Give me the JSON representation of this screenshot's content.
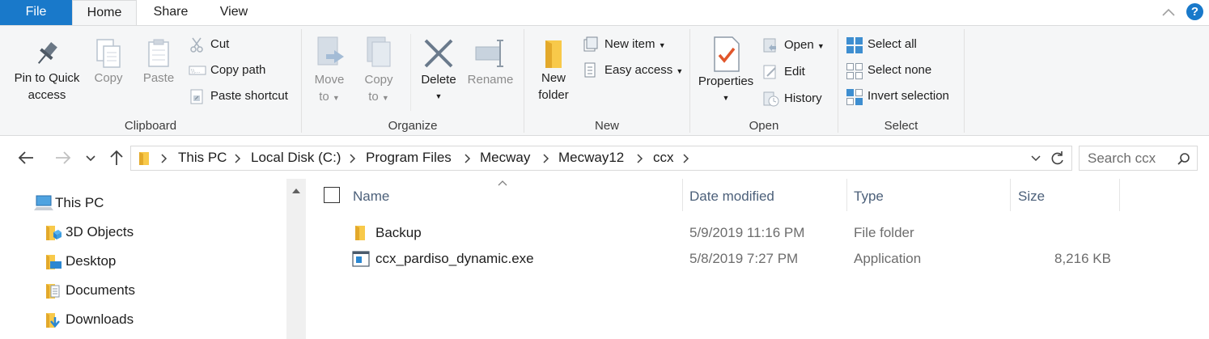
{
  "tabs": {
    "file": "File",
    "home": "Home",
    "share": "Share",
    "view": "View"
  },
  "help": "?",
  "ribbon": {
    "clipboard": {
      "label": "Clipboard",
      "pin": [
        "Pin to Quick",
        "access"
      ],
      "copy": "Copy",
      "paste": "Paste",
      "cut": "Cut",
      "copy_path": "Copy path",
      "paste_shortcut": "Paste shortcut"
    },
    "organize": {
      "label": "Organize",
      "move_to": [
        "Move",
        "to"
      ],
      "copy_to": [
        "Copy",
        "to"
      ],
      "delete": "Delete",
      "rename": "Rename"
    },
    "new": {
      "label": "New",
      "new_folder": [
        "New",
        "folder"
      ],
      "new_item": "New item",
      "easy_access": "Easy access"
    },
    "open": {
      "label": "Open",
      "properties": "Properties",
      "open": "Open",
      "edit": "Edit",
      "history": "History"
    },
    "select": {
      "label": "Select",
      "select_all": "Select all",
      "select_none": "Select none",
      "invert_selection": "Invert selection"
    }
  },
  "address": {
    "crumbs": [
      "This PC",
      "Local Disk (C:)",
      "Program Files",
      "Mecway",
      "Mecway12",
      "ccx"
    ],
    "search_placeholder": "Search ccx"
  },
  "navpane": {
    "items": [
      "This PC",
      "3D Objects",
      "Desktop",
      "Documents",
      "Downloads"
    ]
  },
  "columns": {
    "name": "Name",
    "date": "Date modified",
    "type": "Type",
    "size": "Size"
  },
  "files": [
    {
      "name": "Backup",
      "date": "5/9/2019 11:16 PM",
      "type": "File folder",
      "size": "",
      "icon": "folder-icon"
    },
    {
      "name": "ccx_pardiso_dynamic.exe",
      "date": "5/8/2019 7:27 PM",
      "type": "Application",
      "size": "8,216 KB",
      "icon": "application-icon"
    }
  ],
  "colors": {
    "accent": "#1979ca",
    "ribbon_bg": "#f5f6f7",
    "folder": "#f8c94a"
  }
}
